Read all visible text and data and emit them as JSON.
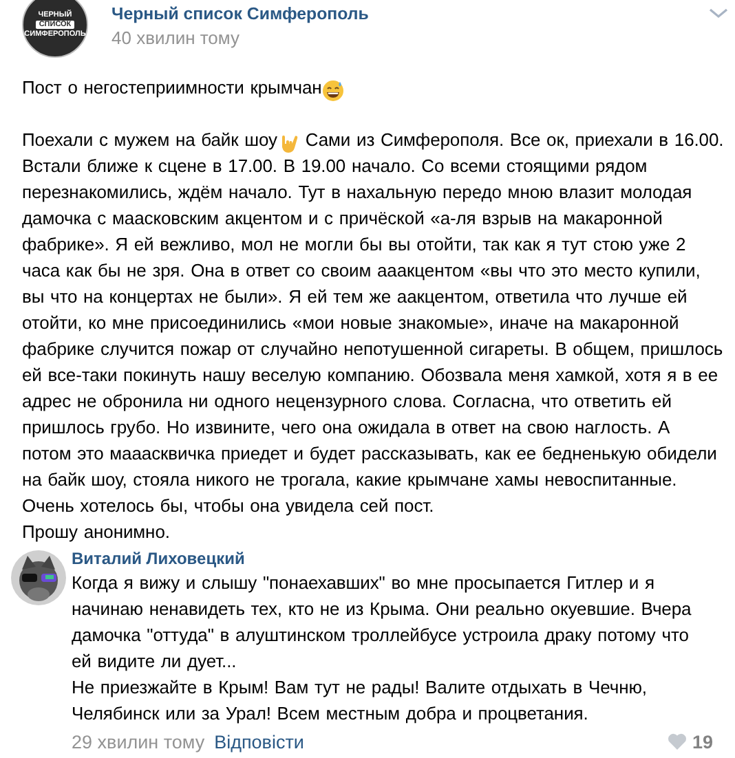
{
  "post": {
    "avatar_lines": [
      "ЧЕРНЫЙ",
      "СПИСОК",
      "СИМФЕРОПОЛЬ"
    ],
    "author": "Черный список Симферополь",
    "time": "40 хвилин тому",
    "headline": "Пост о негостеприимности крымчан",
    "body_start": "Поехали с мужем на байк шоу",
    "body_rest": " Сами из Симферополя. Все ок, приехали в 16.00. Встали ближе к сцене в 17.00. В 19.00 начало. Со всеми стоящими рядом перезнакомились, ждём начало. Тут в нахальную передо мною влазит молодая дамочка с маасковским акцентом и с причёской «а-ля взрыв на макаронной фабрике». Я ей вежливо, мол не могли бы вы отойти, так как я тут стою уже 2 часа как бы не зря. Она в ответ со своим ааакцентом «вы что это место купили, вы что на концертах не были». Я ей тем же аакцентом, ответила что лучше ей отойти, ко мне присоединились «мои новые знакомые», иначе на макаронной фабрике случится пожар от случайно непотушенной сигареты. В общем, пришлось ей все-таки покинуть нашу веселую компанию. Обозвала меня хамкой, хотя я в ее адрес не обронила ни одного нецензурного слова. Согласна, что ответить ей пришлось грубо. Но извините, чего она ожидала в ответ на свою наглость. А потом это мааасквичка приедет и будет рассказывать, как ее бедненькую обидели на байк шоу, стояла никого не трогала, какие крымчане хамы невоспитанные. Очень хотелось бы, чтобы она увидела сей пост.",
    "closing": "Прошу анонимно."
  },
  "comment": {
    "author": "Виталий Лиховецкий",
    "paragraphs": [
      "Когда я вижу и слышу \"понаехавших\" во мне просыпается Гитлер и я начинаю ненавидеть тех, кто не из Крыма. Они реально окуевшие. Вчера дамочка \"оттуда\" в алуштинском троллейбусе устроила драку потому что ей видите ли дует...",
      "Не приезжайте в Крым! Вам тут не рады! Валите отдыхать в Чечню, Челябинск или за Урал! Всем местным добра и процветания."
    ],
    "time": "29 хвилин тому",
    "reply": "Відповісти",
    "likes": "19",
    "liked": false
  }
}
